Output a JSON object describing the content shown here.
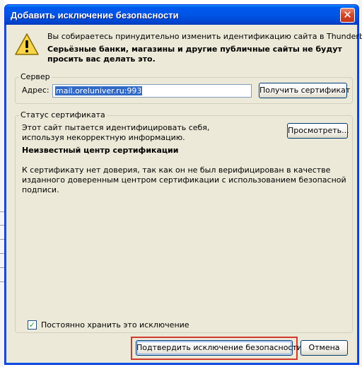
{
  "dialog": {
    "title": "Добавить исключение безопасности",
    "close_glyph": "✕",
    "warning_icon": "warning-icon",
    "intro": "Вы собираетесь принудительно изменить идентификацию сайта в Thunderbird.",
    "warning": "Серьёзные банки, магазины и другие публичные сайты не будут просить вас делать это."
  },
  "server": {
    "legend": "Сервер",
    "address_label": "Адрес:",
    "address_value": "mail.oreluniver.ru:993",
    "get_cert_button": "Получить сертификат"
  },
  "status": {
    "legend": "Статус сертификата",
    "message": "Этот сайт пытается идентифицировать себя, используя некорректную информацию.",
    "view_button": "Просмотреть...",
    "issue_title": "Неизвестный центр сертификации",
    "issue_text": "К сертификату нет доверия, так как он не был верифицирован в качестве изданного доверенным центром сертификации с использованием безопасной подписи."
  },
  "options": {
    "permanent_label": "Постоянно хранить это исключение",
    "permanent_checked": true
  },
  "actions": {
    "confirm_button": "Подтвердить исключение безопасности",
    "cancel_button": "Отмена"
  },
  "colors": {
    "titlebar": "#0055e5",
    "highlight": "#d13a2e",
    "selection": "#316ac5"
  }
}
